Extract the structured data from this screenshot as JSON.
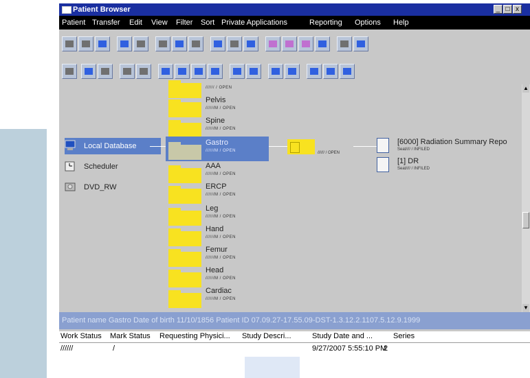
{
  "window": {
    "title": "Patient Browser",
    "controls": [
      "_",
      "□",
      "x"
    ]
  },
  "menu": [
    "Patient",
    "Transfer",
    "Edit",
    "View",
    "Filter",
    "Sort",
    "Private Applications",
    "Reporting",
    "Options",
    "Help"
  ],
  "sources": [
    {
      "label": "Local Database",
      "icon": "monitor-icon",
      "selected": true
    },
    {
      "label": "Scheduler",
      "icon": "clock-icon",
      "selected": false
    },
    {
      "label": "DVD_RW",
      "icon": "disc-drive-icon",
      "selected": false
    }
  ],
  "studies_top_fragment": "////// / OPEN",
  "studies": [
    {
      "name": "Pelvis",
      "status": "//////M / OPEN"
    },
    {
      "name": "Spine",
      "status": "//////M / OPEN"
    },
    {
      "name": "Gastro",
      "status": "//////M / OPEN",
      "selected": true
    },
    {
      "name": "AAA",
      "status": "//////M / OPEN"
    },
    {
      "name": "ERCP",
      "status": "//////M / OPEN"
    },
    {
      "name": "Leg",
      "status": "//////M / OPEN"
    },
    {
      "name": "Hand",
      "status": "//////M / OPEN"
    },
    {
      "name": "Femur",
      "status": "//////M / OPEN"
    },
    {
      "name": "Head",
      "status": "//////M / OPEN"
    },
    {
      "name": "Cardiac",
      "status": "//////M / OPEN"
    }
  ],
  "study_node": {
    "status": "////// / OPEN"
  },
  "series": [
    {
      "name": "[6000] Radiation Summary Repo",
      "status": "Seat//// / INFILED"
    },
    {
      "name": "[1] DR",
      "status": "Seat//// / INFILED"
    }
  ],
  "infobar": "Patient name Gastro   Date of birth 11/10/1856 Patient ID 07.09.27-17.55.09-DST-1.3.12.2.1107.5.12.9.1999",
  "grid": {
    "columns": [
      "Work Status",
      "Mark Status",
      "Requesting Physici...",
      "Study Descri...",
      "Study Date and ...",
      "Series"
    ],
    "row": {
      "work_status": "//////",
      "mark_status": "/",
      "study_date": "9/27/2007 5:55:10 PM",
      "series": "2"
    }
  },
  "colors": {
    "titlebar": "#1a2fa0",
    "selection": "#5b7fc8",
    "folder": "#f8e220",
    "infobar": "#8aa0d0"
  }
}
